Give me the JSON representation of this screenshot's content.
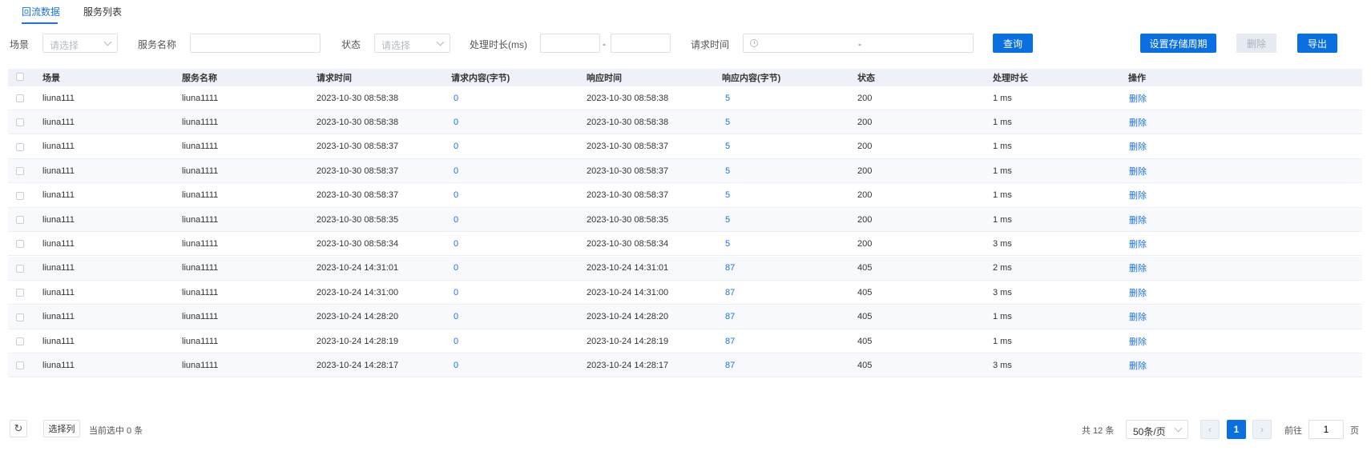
{
  "tabs": [
    {
      "label": "回流数据",
      "active": true
    },
    {
      "label": "服务列表",
      "active": false
    }
  ],
  "filters": {
    "scene_label": "场景",
    "scene_placeholder": "请选择",
    "service_name_label": "服务名称",
    "service_name_value": "",
    "status_label": "状态",
    "status_placeholder": "请选择",
    "duration_label": "处理时长(ms)",
    "duration_min": "",
    "duration_max": "",
    "range_separator": "-",
    "request_time_label": "请求时间",
    "request_time_separator": "-"
  },
  "buttons": {
    "query": "查询",
    "set_storage_period": "设置存储周期",
    "delete": "删除",
    "export": "导出"
  },
  "table": {
    "columns": [
      "场景",
      "服务名称",
      "请求时间",
      "请求内容(字节)",
      "响应时间",
      "响应内容(字节)",
      "状态",
      "处理时长",
      "操作"
    ],
    "rows": [
      {
        "scene": "liuna111",
        "service": "liuna1111",
        "req_time": "2023-10-30 08:58:38",
        "req_size": "0",
        "resp_time": "2023-10-30 08:58:38",
        "resp_size": "5",
        "status": "200",
        "duration": "1 ms",
        "action": "删除"
      },
      {
        "scene": "liuna111",
        "service": "liuna1111",
        "req_time": "2023-10-30 08:58:38",
        "req_size": "0",
        "resp_time": "2023-10-30 08:58:38",
        "resp_size": "5",
        "status": "200",
        "duration": "1 ms",
        "action": "删除"
      },
      {
        "scene": "liuna111",
        "service": "liuna1111",
        "req_time": "2023-10-30 08:58:37",
        "req_size": "0",
        "resp_time": "2023-10-30 08:58:37",
        "resp_size": "5",
        "status": "200",
        "duration": "1 ms",
        "action": "删除"
      },
      {
        "scene": "liuna111",
        "service": "liuna1111",
        "req_time": "2023-10-30 08:58:37",
        "req_size": "0",
        "resp_time": "2023-10-30 08:58:37",
        "resp_size": "5",
        "status": "200",
        "duration": "1 ms",
        "action": "删除"
      },
      {
        "scene": "liuna111",
        "service": "liuna1111",
        "req_time": "2023-10-30 08:58:37",
        "req_size": "0",
        "resp_time": "2023-10-30 08:58:37",
        "resp_size": "5",
        "status": "200",
        "duration": "1 ms",
        "action": "删除"
      },
      {
        "scene": "liuna111",
        "service": "liuna1111",
        "req_time": "2023-10-30 08:58:35",
        "req_size": "0",
        "resp_time": "2023-10-30 08:58:35",
        "resp_size": "5",
        "status": "200",
        "duration": "1 ms",
        "action": "删除"
      },
      {
        "scene": "liuna111",
        "service": "liuna1111",
        "req_time": "2023-10-30 08:58:34",
        "req_size": "0",
        "resp_time": "2023-10-30 08:58:34",
        "resp_size": "5",
        "status": "200",
        "duration": "3 ms",
        "action": "删除"
      },
      {
        "scene": "liuna111",
        "service": "liuna1111",
        "req_time": "2023-10-24 14:31:01",
        "req_size": "0",
        "resp_time": "2023-10-24 14:31:01",
        "resp_size": "87",
        "status": "405",
        "duration": "2 ms",
        "action": "删除"
      },
      {
        "scene": "liuna111",
        "service": "liuna1111",
        "req_time": "2023-10-24 14:31:00",
        "req_size": "0",
        "resp_time": "2023-10-24 14:31:00",
        "resp_size": "87",
        "status": "405",
        "duration": "3 ms",
        "action": "删除"
      },
      {
        "scene": "liuna111",
        "service": "liuna1111",
        "req_time": "2023-10-24 14:28:20",
        "req_size": "0",
        "resp_time": "2023-10-24 14:28:20",
        "resp_size": "87",
        "status": "405",
        "duration": "1 ms",
        "action": "删除"
      },
      {
        "scene": "liuna111",
        "service": "liuna1111",
        "req_time": "2023-10-24 14:28:19",
        "req_size": "0",
        "resp_time": "2023-10-24 14:28:19",
        "resp_size": "87",
        "status": "405",
        "duration": "1 ms",
        "action": "删除"
      },
      {
        "scene": "liuna111",
        "service": "liuna1111",
        "req_time": "2023-10-24 14:28:17",
        "req_size": "0",
        "resp_time": "2023-10-24 14:28:17",
        "resp_size": "87",
        "status": "405",
        "duration": "3 ms",
        "action": "删除"
      }
    ]
  },
  "footer": {
    "refresh_icon": "refresh-icon",
    "select_columns": "选择列",
    "selected_text": "当前选中 0 条",
    "total_text": "共 12 条",
    "page_size": "50条/页",
    "current_page": "1",
    "goto_label": "前往",
    "goto_value": "1",
    "page_suffix": "页"
  },
  "colors": {
    "accent": "#0a6fe0",
    "link": "#1a73e8",
    "header_bg": "#eef2f8"
  }
}
